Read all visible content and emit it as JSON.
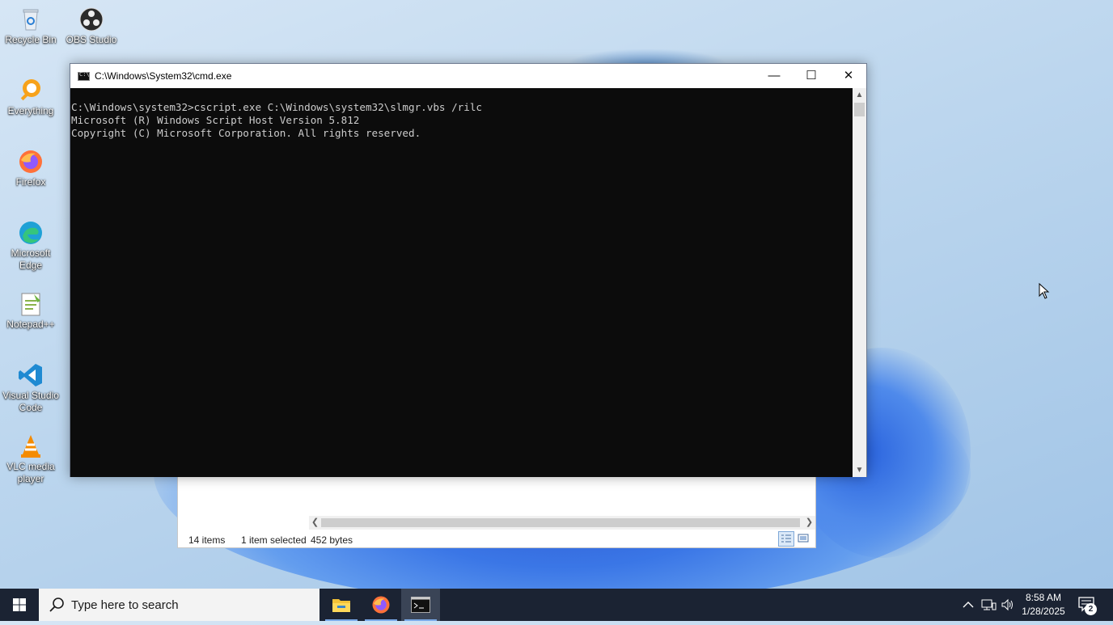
{
  "desktop": {
    "icons": [
      {
        "label": "Recycle Bin"
      },
      {
        "label": "OBS Studio"
      },
      {
        "label": "Everything"
      },
      {
        "label": "Firefox"
      },
      {
        "label": "Microsoft Edge"
      },
      {
        "label": "Notepad++"
      },
      {
        "label": "Visual Studio Code"
      },
      {
        "label": "VLC media player"
      }
    ]
  },
  "explorer": {
    "status_items": "14 items",
    "status_selected": "1 item selected",
    "status_size": "452 bytes"
  },
  "cmd": {
    "title": "C:\\Windows\\System32\\cmd.exe",
    "lines": [
      "C:\\Windows\\system32>cscript.exe C:\\Windows\\system32\\slmgr.vbs /rilc",
      "Microsoft (R) Windows Script Host Version 5.812",
      "Copyright (C) Microsoft Corporation. All rights reserved."
    ],
    "minimize_glyph": "—",
    "maximize_glyph": "☐",
    "close_glyph": "✕"
  },
  "taskbar": {
    "search_placeholder": "Type here to search",
    "apps": [
      "file-explorer",
      "firefox",
      "command-prompt"
    ],
    "clock_time": "8:58 AM",
    "clock_date": "1/28/2025",
    "notification_count": "2"
  },
  "colors": {
    "taskbar_bg": "#1b2333",
    "console_bg": "#0c0c0c",
    "console_text": "#cccccc"
  }
}
